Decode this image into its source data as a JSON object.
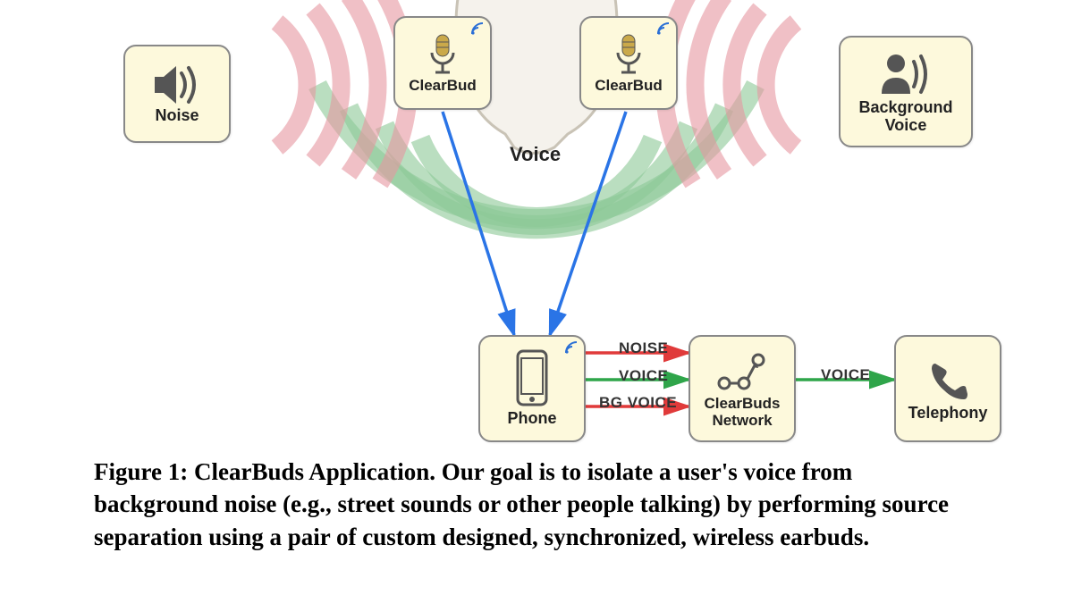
{
  "caption": "Figure 1:  ClearBuds Application. Our goal is to isolate a user's voice from background noise (e.g., street sounds or other people talking) by performing source separation using a pair of custom designed, synchronized, wireless earbuds.",
  "labels": {
    "noise": "Noise",
    "clearbud_left": "ClearBud",
    "clearbud_right": "ClearBud",
    "background_voice": "Background\nVoice",
    "voice_center": "Voice",
    "phone": "Phone",
    "clearbuds_network": "ClearBuds\nNetwork",
    "telephony": "Telephony"
  },
  "edges": {
    "noise_to_phone": "NOISE",
    "voice_to_phone": "VOICE",
    "bgvoice_to_phone": "BG VOICE",
    "network_to_telephony": "VOICE"
  },
  "colors": {
    "arrow_blue": "#2a74e6",
    "arrow_red": "#e03a3a",
    "arrow_green": "#2fa54a",
    "box_fill": "#fdf9dc",
    "box_border": "#888888",
    "arc_green": "rgba(140,200,150,0.55)",
    "arc_pink": "rgba(230,150,160,0.55)"
  }
}
